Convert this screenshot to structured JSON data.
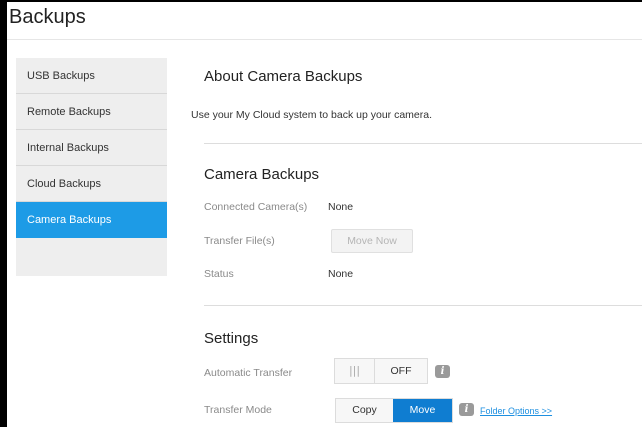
{
  "page": {
    "title": "Backups"
  },
  "sidebar": {
    "items": [
      {
        "label": "USB Backups"
      },
      {
        "label": "Remote Backups"
      },
      {
        "label": "Internal Backups"
      },
      {
        "label": "Cloud Backups"
      },
      {
        "label": "Camera Backups",
        "active": true
      }
    ]
  },
  "about": {
    "title": "About Camera Backups",
    "description": "Use your My Cloud system to back up your camera."
  },
  "camera": {
    "title": "Camera Backups",
    "connected_label": "Connected Camera(s)",
    "connected_value": "None",
    "transfer_label": "Transfer File(s)",
    "move_now_label": "Move Now",
    "status_label": "Status",
    "status_value": "None"
  },
  "settings": {
    "title": "Settings",
    "auto_transfer_label": "Automatic Transfer",
    "toggle_grip": "|||",
    "toggle_state": "OFF",
    "transfer_mode_label": "Transfer Mode",
    "mode_options": [
      "Copy",
      "Move"
    ],
    "selected_mode": "Move",
    "folder_options_link": "Folder Options >>"
  },
  "colors": {
    "accent": "#1d9be6",
    "selected_button": "#0f7dd1",
    "link": "#1d8fe0"
  },
  "icons": {
    "info": "info-icon"
  }
}
